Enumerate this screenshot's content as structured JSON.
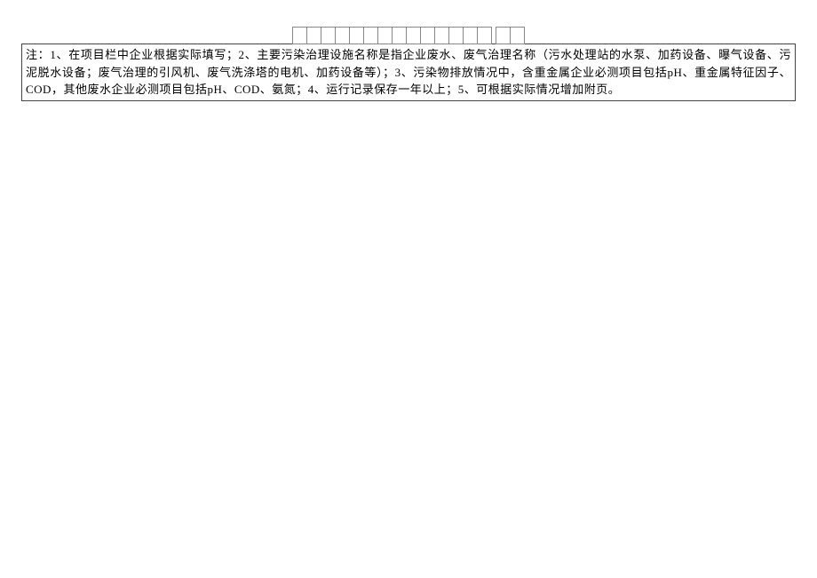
{
  "note": "注：1、在项目栏中企业根据实际填写；2、主要污染治理设施名称是指企业废水、废气治理名称（污水处理站的水泵、加药设备、曝气设备、污泥脱水设备；废气治理的引风机、废气洗涤塔的电机、加药设备等）；3、污染物排放情况中，含重金属企业必测项目包括pH、重金属特征因子、COD，其他废水企业必测项目包括pH、COD、氨氮；4、运行记录保存一年以上；5、可根据实际情况增加附页。"
}
